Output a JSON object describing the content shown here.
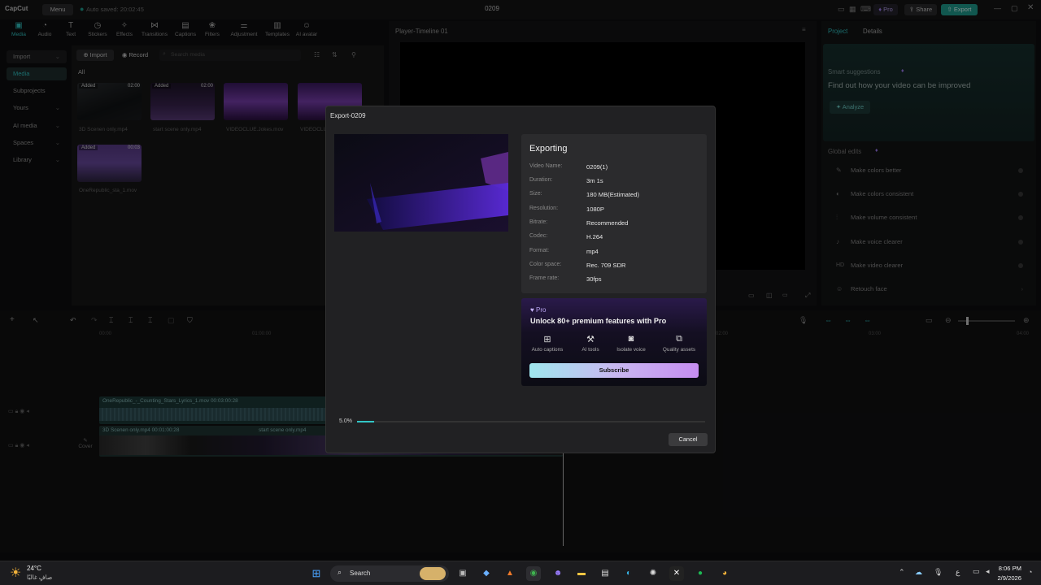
{
  "titlebar": {
    "app_name": "CapCut",
    "menu_label": "Menu",
    "autosave": "Auto saved: 20:02:45",
    "project_title": "0209",
    "pro_label": "Pro",
    "share_label": "Share",
    "export_label": "Export"
  },
  "toolbar": {
    "items": [
      {
        "label": "Media",
        "icon": "media-icon"
      },
      {
        "label": "Audio",
        "icon": "audio-icon"
      },
      {
        "label": "Text",
        "icon": "text-icon"
      },
      {
        "label": "Stickers",
        "icon": "stickers-icon"
      },
      {
        "label": "Effects",
        "icon": "effects-icon"
      },
      {
        "label": "Transitions",
        "icon": "transitions-icon"
      },
      {
        "label": "Captions",
        "icon": "captions-icon"
      },
      {
        "label": "Filters",
        "icon": "filters-icon"
      },
      {
        "label": "Adjustment",
        "icon": "adjustment-icon"
      },
      {
        "label": "Templates",
        "icon": "templates-icon"
      },
      {
        "label": "AI avatar",
        "icon": "ai-avatar-icon"
      }
    ]
  },
  "sidebar": {
    "items": [
      {
        "label": "Import",
        "chevron": true
      },
      {
        "label": "Media",
        "chevron": false
      },
      {
        "label": "Subprojects",
        "chevron": false
      },
      {
        "label": "Yours",
        "chevron": true
      },
      {
        "label": "AI media",
        "chevron": true
      },
      {
        "label": "Spaces",
        "chevron": true
      },
      {
        "label": "Library",
        "chevron": true
      }
    ]
  },
  "media_panel": {
    "import_label": "Import",
    "record_label": "Record",
    "search_placeholder": "Search media",
    "filter_all": "All",
    "items": [
      {
        "name": "3D Scenen only.mp4",
        "badge": "Added",
        "duration": "02:00"
      },
      {
        "name": "start scene only.mp4",
        "badge": "Added",
        "duration": "02:00"
      },
      {
        "name": "VIDEOCLUE.Jokes.mov",
        "badge": "",
        "duration": ""
      },
      {
        "name": "VIDEOCLUE",
        "badge": "",
        "duration": ""
      },
      {
        "name": "OneRepublic_sta_1.mov",
        "badge": "Added",
        "duration": "00:03"
      }
    ]
  },
  "player": {
    "title": "Player-Timeline 01"
  },
  "right_panel": {
    "tab_project": "Project",
    "tab_details": "Details",
    "smart_title": "Smart suggestions",
    "smart_subtitle": "Find out how your video can be improved",
    "analyze_label": "Analyze",
    "global_edits_title": "Global edits",
    "global_edits": [
      {
        "label": "Make colors better",
        "icon": "color-wand-icon"
      },
      {
        "label": "Make colors consistent",
        "icon": "color-consistent-icon"
      },
      {
        "label": "Make volume consistent",
        "icon": "volume-icon"
      },
      {
        "label": "Make voice clearer",
        "icon": "voice-icon"
      },
      {
        "label": "Make video clearer",
        "icon": "hd-icon"
      },
      {
        "label": "Retouch face",
        "icon": "face-icon"
      }
    ]
  },
  "timeline": {
    "ruler": [
      "00:00",
      "01:00:00",
      "02:00",
      "03:00",
      "04:00"
    ],
    "track1_label": "OneRepublic_-_Counting_Stars_Lyrics_1.mov  00:03:00:28",
    "track2_label": "3D Scenen only.mp4  00:01:00:28",
    "track2b_label": "start scene only.mp4",
    "cover_label": "Cover"
  },
  "dialog": {
    "title": "Export-0209",
    "heading": "Exporting",
    "rows": [
      {
        "key": "Video Name:",
        "value": "0209(1)"
      },
      {
        "key": "Duration:",
        "value": "3m 1s"
      },
      {
        "key": "Size:",
        "value": "180 MB(Estimated)"
      },
      {
        "key": "Resolution:",
        "value": "1080P"
      },
      {
        "key": "Bitrate:",
        "value": "Recommended"
      },
      {
        "key": "Codec:",
        "value": "H.264"
      },
      {
        "key": "Format:",
        "value": "mp4"
      },
      {
        "key": "Color space:",
        "value": "Rec. 709 SDR"
      },
      {
        "key": "Frame rate:",
        "value": "30fps"
      }
    ],
    "pro_badge": "Pro",
    "pro_headline": "Unlock 80+ premium features with Pro",
    "pro_features": [
      {
        "label": "Auto captions",
        "icon": "auto-captions-icon"
      },
      {
        "label": "AI tools",
        "icon": "ai-tools-icon"
      },
      {
        "label": "Isolate voice",
        "icon": "isolate-voice-icon"
      },
      {
        "label": "Quality assets",
        "icon": "quality-assets-icon"
      }
    ],
    "subscribe_label": "Subscribe",
    "progress_text": "5.0%",
    "progress_fraction": 0.05,
    "cancel_label": "Cancel"
  },
  "taskbar": {
    "weather_temp": "24°C",
    "weather_desc": "صافٍ غالبًا",
    "search_label": "Search",
    "time": "8:06 PM",
    "date": "2/9/2026",
    "lang": "ع"
  },
  "colors": {
    "accent": "#32c6c6",
    "export_btn": "#1f9e91",
    "pro_purple": "#a07ef5"
  }
}
